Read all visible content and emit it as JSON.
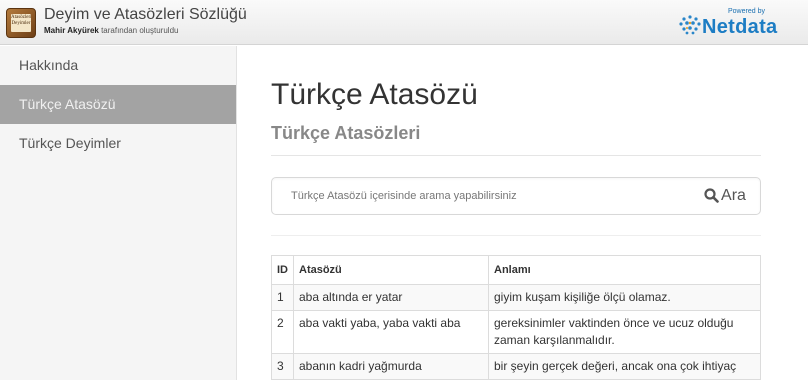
{
  "header": {
    "logo_text": "Atasözleri Deyimler",
    "title": "Deyim ve Atasözleri Sözlüğü",
    "author": "Mahir Akyürek",
    "created_by": "tarafından oluşturuldu",
    "sponsor_powered": "Powered by",
    "sponsor_brand": "Netdata"
  },
  "sidebar": {
    "items": [
      {
        "label": "Hakkında",
        "active": false
      },
      {
        "label": "Türkçe Atasözü",
        "active": true
      },
      {
        "label": "Türkçe Deyimler",
        "active": false
      }
    ]
  },
  "main": {
    "title": "Türkçe Atasözü",
    "subtitle": "Türkçe Atasözleri",
    "search": {
      "placeholder": "Türkçe Atasözü içerisinde arama yapabilirsiniz",
      "button_label": "Ara",
      "icon": "search-icon"
    },
    "table": {
      "headers": [
        "ID",
        "Atasözü",
        "Anlamı"
      ],
      "rows": [
        {
          "id": "1",
          "atasozu": "aba altında er yatar",
          "anlami": "giyim kuşam kişiliğe ölçü olamaz."
        },
        {
          "id": "2",
          "atasozu": "aba vakti yaba, yaba vakti aba",
          "anlami": "gereksinimler vaktinden önce ve ucuz olduğu zaman karşılanmalıdır."
        },
        {
          "id": "3",
          "atasozu": "abanın kadri yağmurda",
          "anlami": "bir şeyin gerçek değeri, ancak ona çok ihtiyaç"
        }
      ]
    }
  }
}
